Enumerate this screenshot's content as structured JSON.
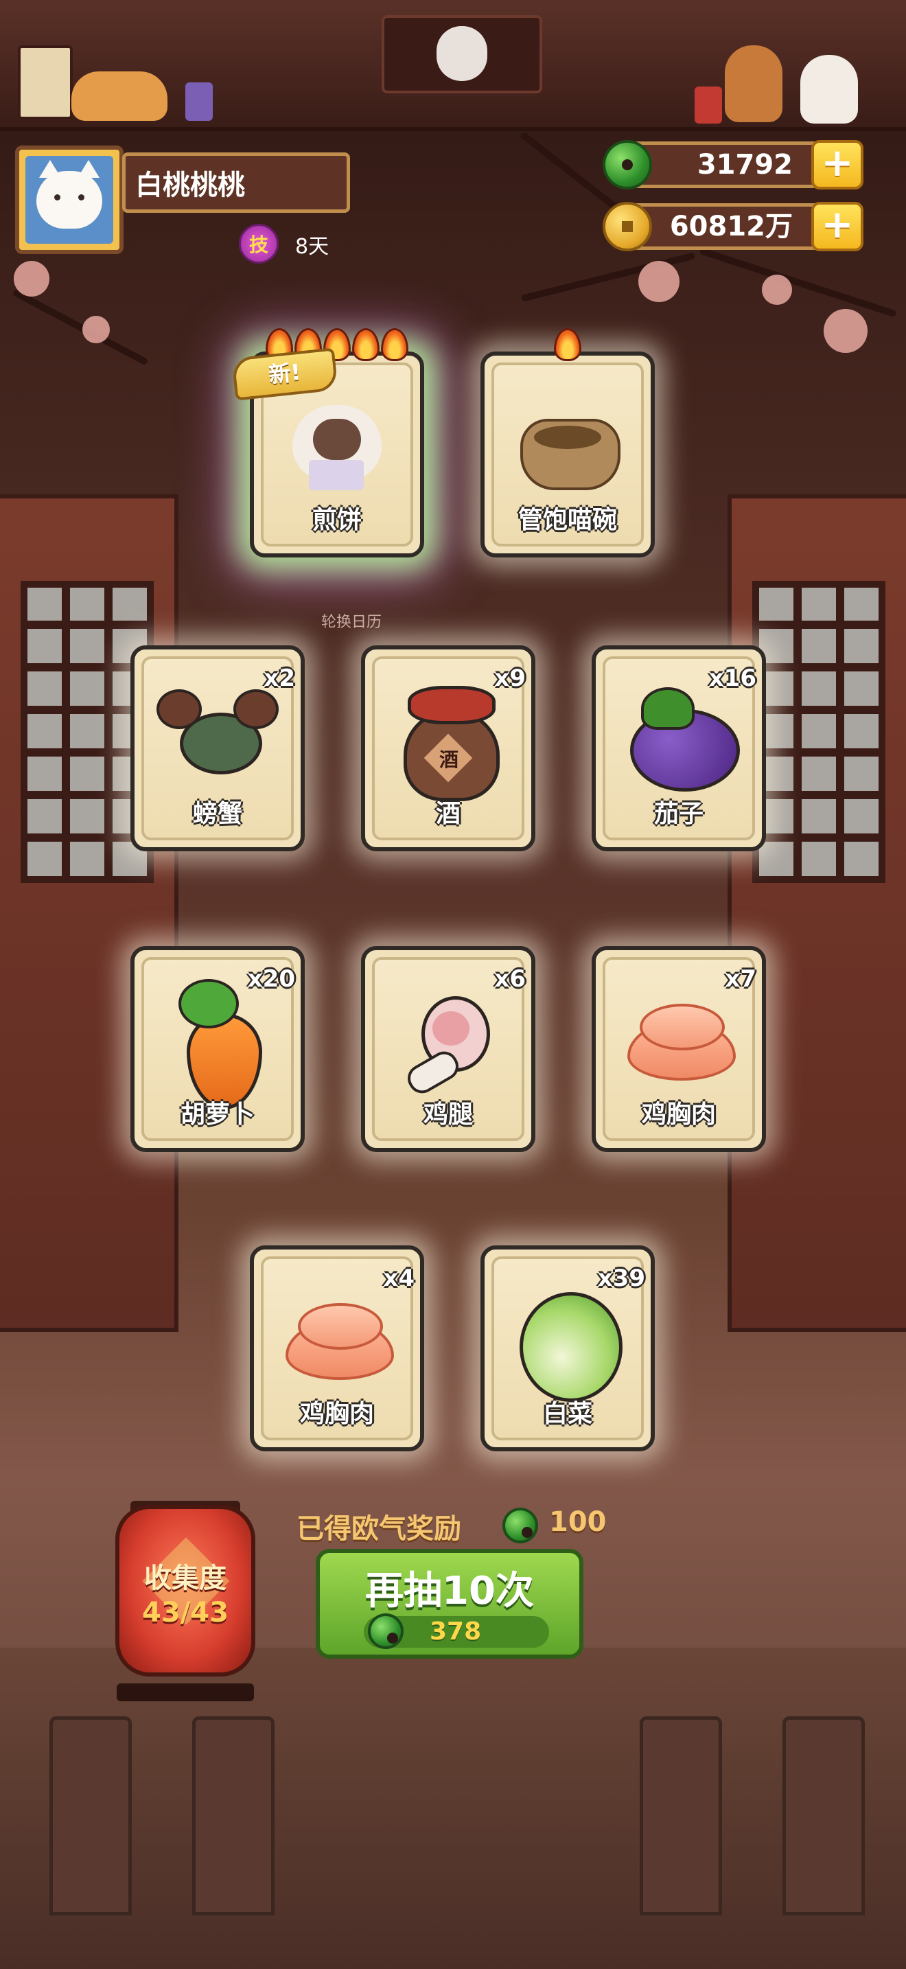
{
  "header": {
    "player_name": "白桃桃桃",
    "skill_badge": "技",
    "days": "8天",
    "jade_amount": "31792",
    "coin_amount": "60812万",
    "plus_label": "+"
  },
  "featured": [
    {
      "name": "煎饼",
      "tag": "新!",
      "flames": 5,
      "art": "siamese-cat-icon"
    },
    {
      "name": "管饱喵碗",
      "flames": 1,
      "art": "cat-bowl-icon"
    }
  ],
  "rotate_label": "轮换日历",
  "items": [
    {
      "name": "螃蟹",
      "count": "x2",
      "art": "crab-icon"
    },
    {
      "name": "酒",
      "count": "x9",
      "art": "wine-jar-icon",
      "jar_label": "酒"
    },
    {
      "name": "茄子",
      "count": "x16",
      "art": "eggplant-icon"
    },
    {
      "name": "胡萝卜",
      "count": "x20",
      "art": "carrot-icon"
    },
    {
      "name": "鸡腿",
      "count": "x6",
      "art": "drumstick-icon"
    },
    {
      "name": "鸡胸肉",
      "count": "x7",
      "art": "chicken-breast-icon"
    },
    {
      "name": "鸡胸肉",
      "count": "x4",
      "art": "chicken-breast-icon"
    },
    {
      "name": "白菜",
      "count": "x39",
      "art": "cabbage-icon"
    }
  ],
  "reward": {
    "label": "已得欧气奖励",
    "value": "100"
  },
  "draw_button": {
    "label": "再抽10次",
    "cost": "378"
  },
  "collection": {
    "title": "收集度",
    "value": "43/43"
  },
  "colors": {
    "accent_green": "#5ea52a",
    "gold": "#f6c770",
    "card_bg": "#f2e2bc"
  }
}
